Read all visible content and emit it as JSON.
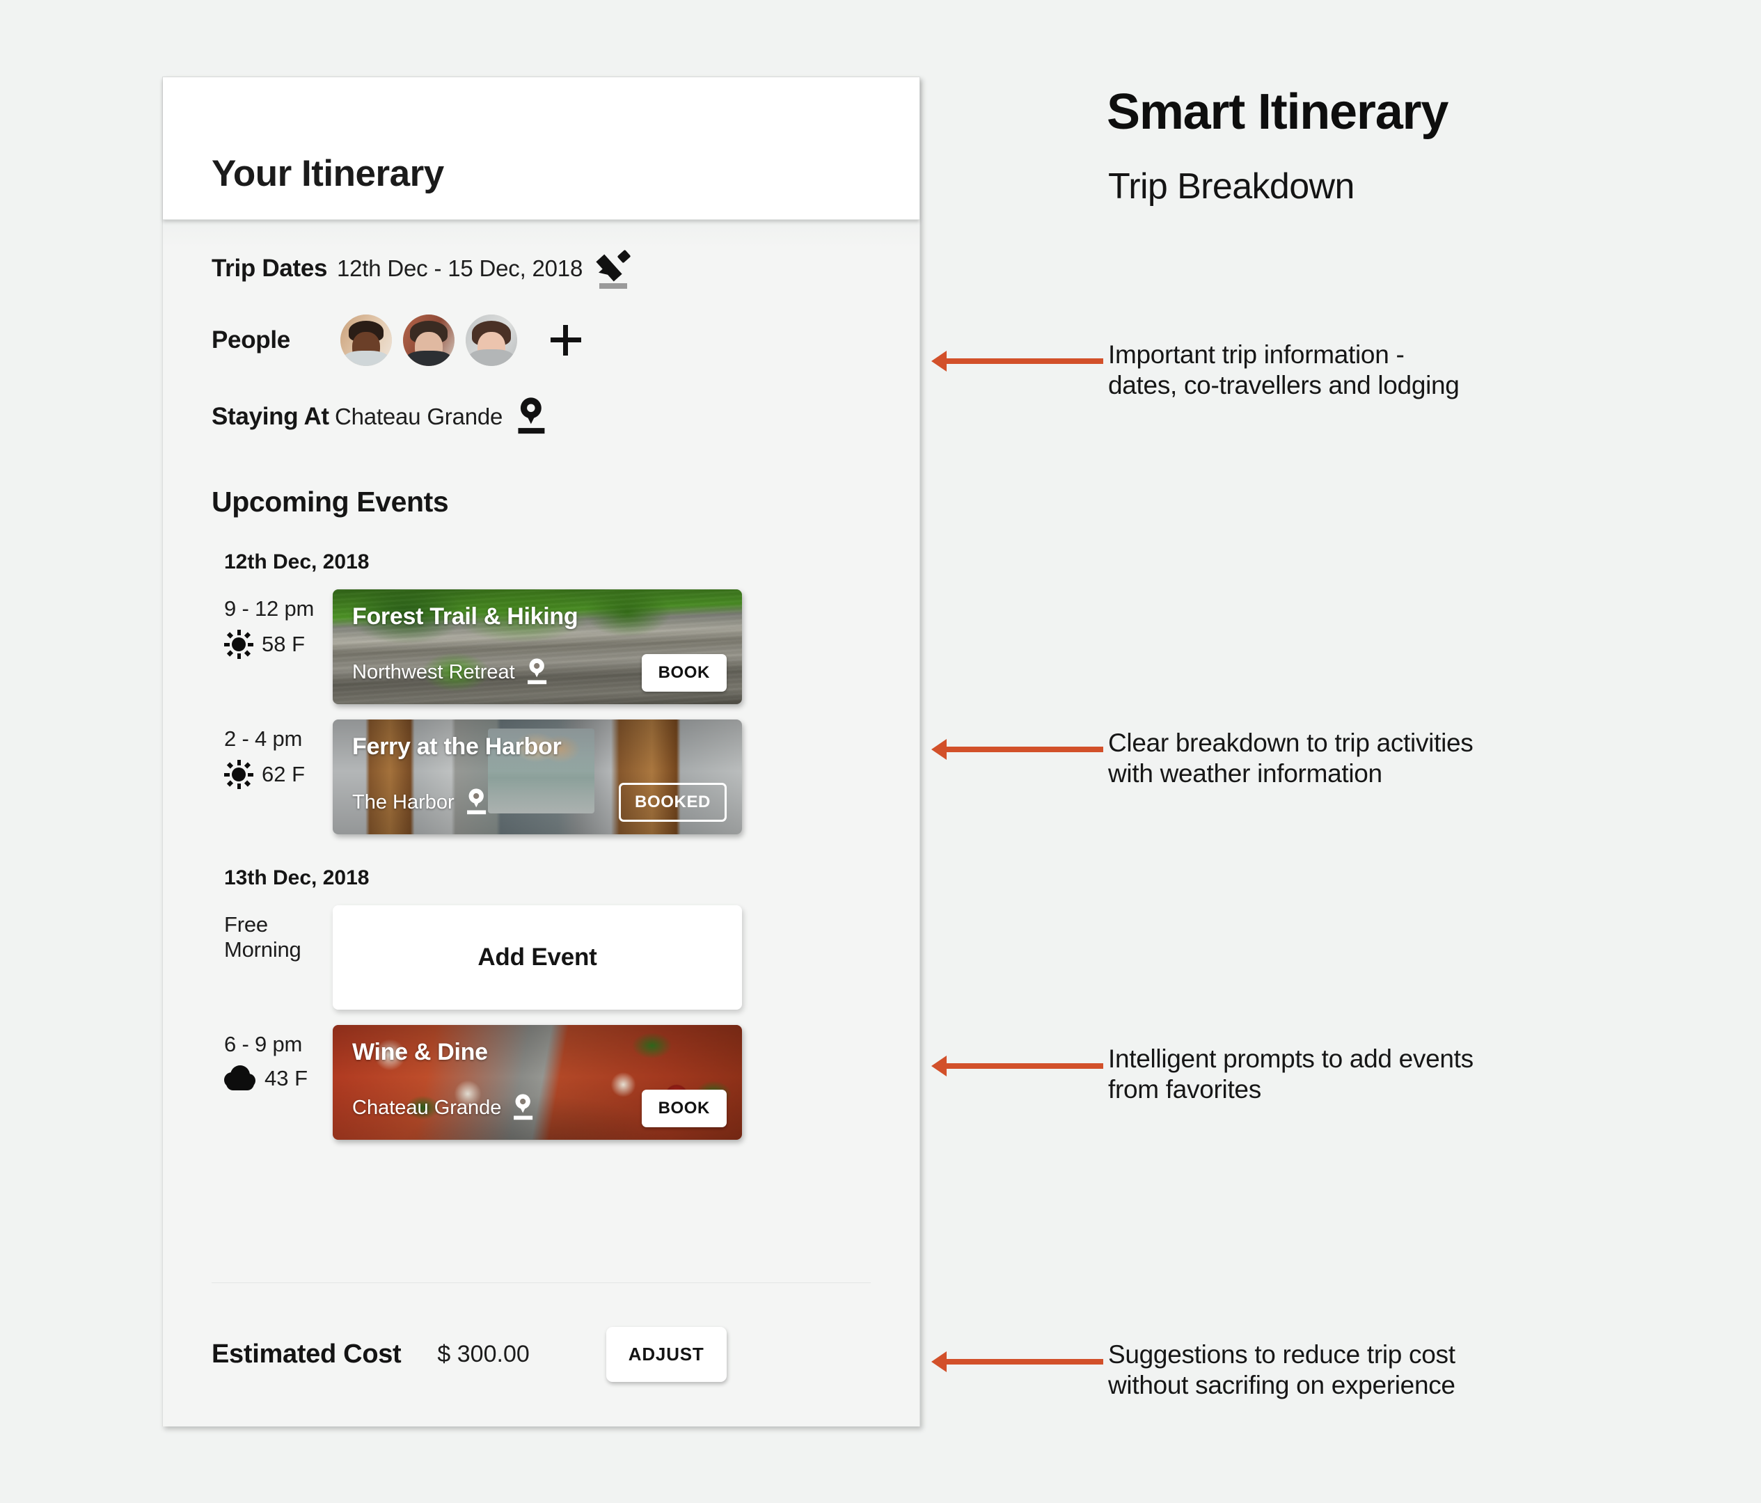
{
  "headline": "Smart Itinerary",
  "subhead": "Trip Breakdown",
  "app": {
    "title": "Your Itinerary",
    "trip_dates": {
      "label": "Trip Dates",
      "value": "12th Dec - 15 Dec, 2018",
      "edit_icon": "pencil-icon"
    },
    "people": {
      "label": "People",
      "add_icon": "plus-icon",
      "count": 3
    },
    "staying_at": {
      "label": "Staying At",
      "value": "Chateau Grande",
      "pin_icon": "location-pin-icon"
    },
    "upcoming_events_heading": "Upcoming Events",
    "days": [
      {
        "date": "12th Dec, 2018",
        "events": [
          {
            "time": "9 - 12 pm",
            "weather_icon": "sun-icon",
            "temperature": "58 F",
            "title": "Forest Trail & Hiking",
            "place": "Northwest Retreat",
            "button": "BOOK",
            "button_style": "solid",
            "photo": "forest-trail-photo"
          },
          {
            "time": "2 - 4 pm",
            "weather_icon": "sun-icon",
            "temperature": "62 F",
            "title": "Ferry at the Harbor",
            "place": "The Harbor",
            "button": "BOOKED",
            "button_style": "outline",
            "photo": "ferry-harbor-photo"
          }
        ]
      },
      {
        "date": "13th Dec, 2018",
        "events": [
          {
            "time": "Free\nMorning",
            "weather_icon": null,
            "temperature": null,
            "add_event_label": "Add Event",
            "type": "add-event"
          },
          {
            "time": "6 - 9 pm",
            "weather_icon": "cloud-icon",
            "temperature": "43 F",
            "title": "Wine & Dine",
            "place": "Chateau Grande",
            "button": "BOOK",
            "button_style": "solid",
            "photo": "wine-dine-photo"
          }
        ]
      }
    ],
    "cost": {
      "label": "Estimated Cost",
      "value": "$ 300.00",
      "adjust_label": "ADJUST"
    }
  },
  "notes": [
    "Important trip information -\ndates, co-travellers and lodging",
    "Clear breakdown to trip activities\nwith weather information",
    "Intelligent prompts to add events\nfrom favorites",
    "Suggestions to reduce trip cost\nwithout sacrifing on experience"
  ],
  "colors": {
    "accent": "#d2502a",
    "page_bg": "#f1f3f2",
    "card_bg": "#f4f5f4",
    "text": "#141414"
  }
}
